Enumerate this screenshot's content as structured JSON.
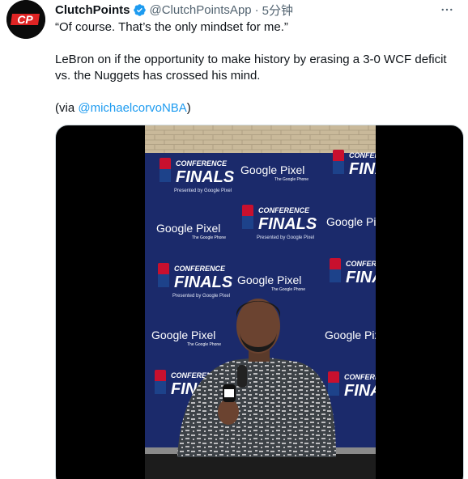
{
  "account": {
    "name": "ClutchPoints",
    "handle": "@ClutchPointsApp",
    "separator": "·",
    "time": "5分钟",
    "avatar_text": "CP",
    "verified_icon": "verified-badge-icon",
    "more_icon": "more-options-icon"
  },
  "tweet": {
    "quote": "“Of course. That’s the only mindset for me.”",
    "body": "LeBron on if the opportunity to make history by erasing a 3-0 WCF deficit vs. the Nuggets has crossed his mind.",
    "via_prefix": "(via ",
    "via_link": "@michaelcorvoNBA",
    "via_suffix": ")"
  },
  "video_backdrop": {
    "conference_text": "CONFERENCE",
    "finals_text": "FINALS",
    "presented_text": "Presented by Google Pixel",
    "google_pixel_text": "Google Pixel",
    "google_phone_text": "The Google Phone",
    "nba_text": "NBA"
  },
  "colors": {
    "accent": "#1d9bf0",
    "backdrop_blue": "#1b2a6b",
    "avatar_red": "#e02424"
  }
}
